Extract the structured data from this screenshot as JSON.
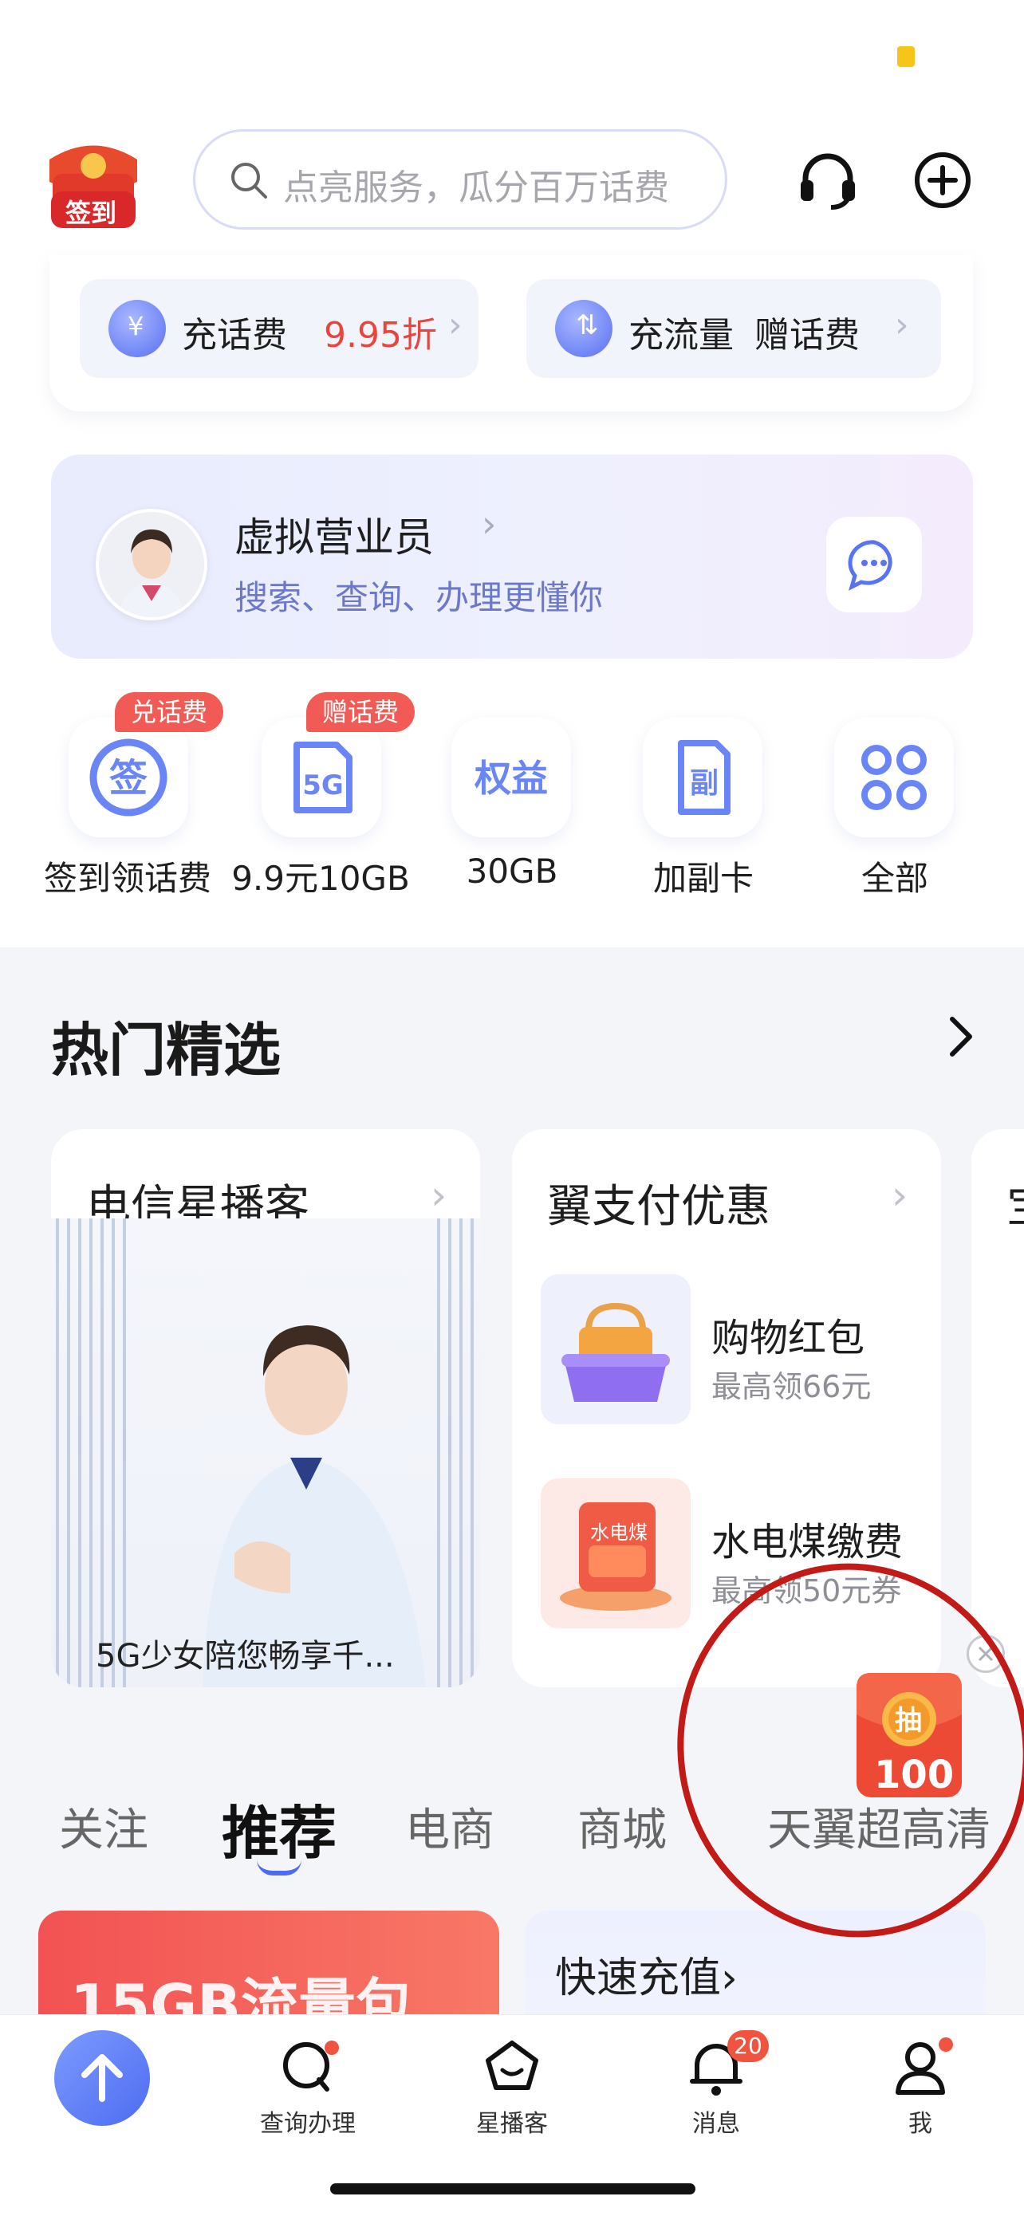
{
  "header": {
    "signin_label": "签到",
    "search_placeholder": "点亮服务，瓜分百万话费"
  },
  "top_pills": [
    {
      "label": "充话费",
      "highlight": "9.95折"
    },
    {
      "label": "充流量",
      "highlight": "赠话费"
    }
  ],
  "assistant": {
    "name": "虚拟营业员",
    "subtitle": "搜索、查询、办理更懂你"
  },
  "quick_items": [
    {
      "label": "签到领话费",
      "badge": "兑话费",
      "icon_text": "签"
    },
    {
      "label": "9.9元10GB",
      "badge": "赠话费",
      "icon_text": "5G"
    },
    {
      "label": "30GB",
      "badge": "",
      "icon_text": "权益"
    },
    {
      "label": "加副卡",
      "badge": "",
      "icon_text": "副"
    },
    {
      "label": "全部",
      "badge": "",
      "icon_text": ""
    }
  ],
  "hot": {
    "title": "热门精选",
    "cards": [
      {
        "title": "电信星播客",
        "caption": "5G少女陪您畅享千..."
      },
      {
        "title": "翼支付优惠",
        "items": [
          {
            "title": "购物红包",
            "sub": "最高领66元"
          },
          {
            "title": "水电煤缴费",
            "sub": "最高领50元券",
            "img_label": "水电煤"
          }
        ]
      },
      {
        "title": "宝"
      }
    ]
  },
  "floating_badge": {
    "label": "抽",
    "amount": "100"
  },
  "feed_tabs": [
    "关注",
    "推荐",
    "电商",
    "商城",
    "天翼超高清"
  ],
  "active_tab_index": 1,
  "feed_cards": [
    {
      "title": "15GB流量包"
    },
    {
      "title": "快速充值›"
    }
  ],
  "tabbar": {
    "items": [
      {
        "label": "查询办理"
      },
      {
        "label": "星播客"
      },
      {
        "label": "消息",
        "count": "20"
      },
      {
        "label": "我"
      }
    ]
  },
  "colors": {
    "accent": "#5870f2",
    "brand_red": "#f25b55",
    "annotation": "#c21a17"
  }
}
